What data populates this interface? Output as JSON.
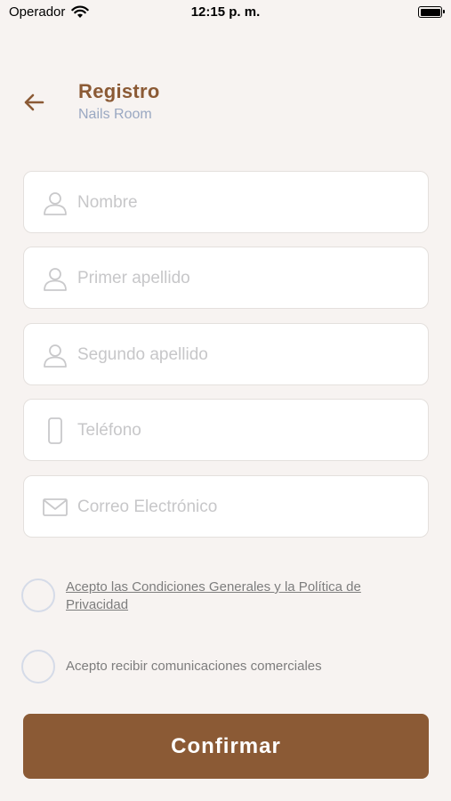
{
  "status_bar": {
    "carrier": "Operador",
    "time": "12:15 p. m.",
    "icons": [
      "wifi-icon",
      "battery-icon"
    ]
  },
  "header": {
    "back_icon": "arrow-left-icon",
    "title": "Registro",
    "subtitle": "Nails Room"
  },
  "form": {
    "fields": [
      {
        "placeholder": "Nombre",
        "value": "",
        "icon": "user-icon"
      },
      {
        "placeholder": "Primer apellido",
        "value": "",
        "icon": "user-icon"
      },
      {
        "placeholder": "Segundo apellido",
        "value": "",
        "icon": "user-icon"
      },
      {
        "placeholder": "Teléfono",
        "value": "",
        "icon": "phone-icon"
      },
      {
        "placeholder": "Correo Electrónico",
        "value": "",
        "icon": "mail-icon"
      }
    ],
    "checkboxes": [
      {
        "label": "Acepto las Condiciones Generales y la Política de Privacidad",
        "checked": false,
        "is_link": true
      },
      {
        "label": "Acepto recibir comunicaciones comerciales",
        "checked": false,
        "is_link": false
      }
    ],
    "confirm_label": "Confirmar"
  },
  "colors": {
    "accent": "#8b5a35",
    "subtitle": "#9aa8c2",
    "background": "#f7f3f1",
    "field_background": "#ffffff",
    "placeholder": "#c7c7c9"
  }
}
